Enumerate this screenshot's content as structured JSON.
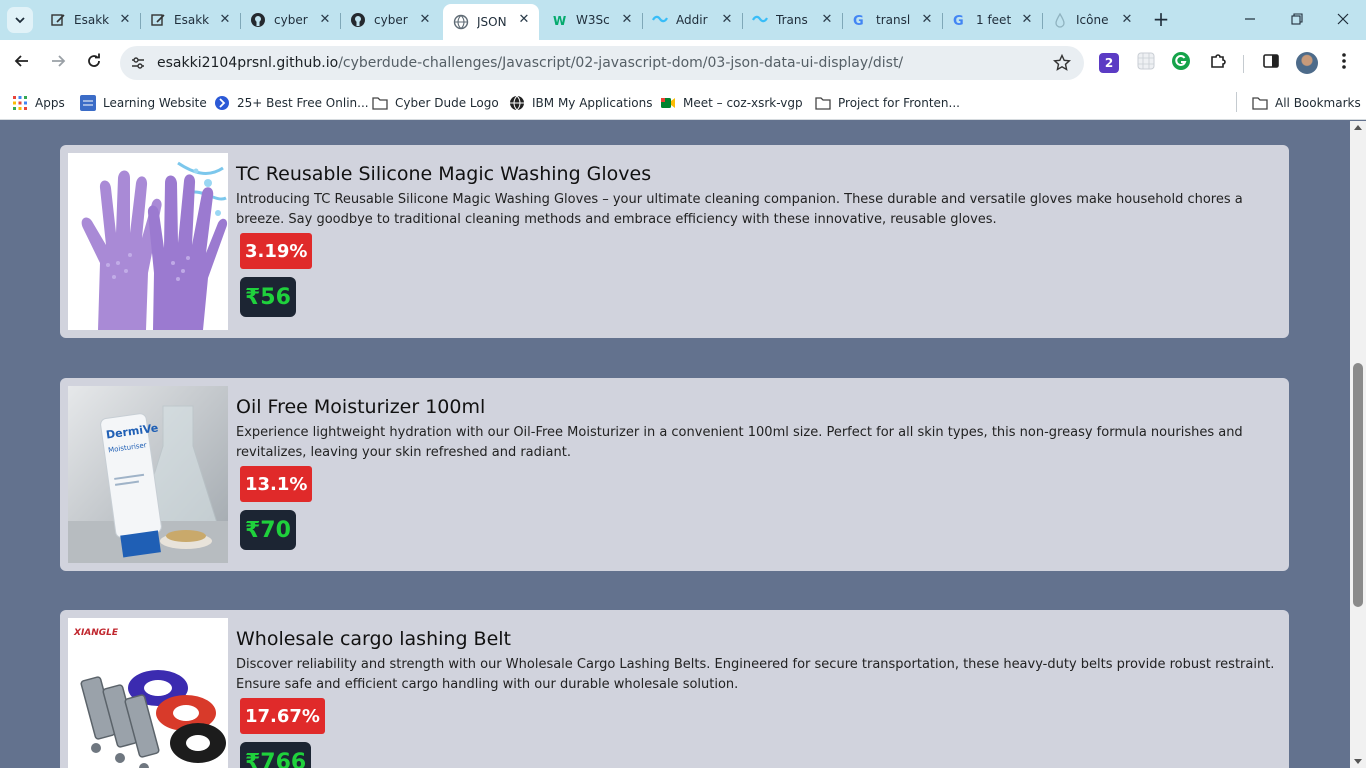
{
  "browser": {
    "tabs": [
      {
        "label": "Esakk",
        "icon": "edit-icon"
      },
      {
        "label": "Esakk",
        "icon": "edit-icon"
      },
      {
        "label": "cyber",
        "icon": "github-icon"
      },
      {
        "label": "cyber",
        "icon": "github-icon"
      },
      {
        "label": "JSON",
        "icon": "globe-icon",
        "active": true
      },
      {
        "label": "W3Sc",
        "icon": "w3schools-icon"
      },
      {
        "label": "Addir",
        "icon": "tailwind-icon"
      },
      {
        "label": "Trans",
        "icon": "tailwind-icon"
      },
      {
        "label": "transl",
        "icon": "google-icon"
      },
      {
        "label": "1 feet",
        "icon": "google-icon"
      },
      {
        "label": "Icône",
        "icon": "drop-icon"
      }
    ],
    "close_glyph": "✕",
    "new_tab_glyph": "+",
    "url_host": "esakki2104prsnl.github.io",
    "url_path": "/cyberdude-challenges/Javascript/02-javascript-dom/03-json-data-ui-display/dist/",
    "extension_badge": "2",
    "bookmarks": [
      {
        "label": "Apps",
        "icon": "apps-grid-icon"
      },
      {
        "label": "Learning Website",
        "icon": "css-grid-icon"
      },
      {
        "label": "25+ Best Free Onlin...",
        "icon": "site-icon"
      },
      {
        "label": "Cyber Dude Logo",
        "icon": "folder-icon"
      },
      {
        "label": "IBM My Applications",
        "icon": "globe-icon"
      },
      {
        "label": "Meet – coz-xsrk-vgp",
        "icon": "meet-icon"
      },
      {
        "label": "Project for Fronten...",
        "icon": "folder-icon"
      }
    ],
    "all_bookmarks": "All Bookmarks"
  },
  "products": [
    {
      "title": "TC Reusable Silicone Magic Washing Gloves",
      "description": "Introducing TC Reusable Silicone Magic Washing Gloves – your ultimate cleaning companion. These durable and versatile gloves make household chores a breeze. Say goodbye to traditional cleaning methods and embrace efficiency with these innovative, reusable gloves.",
      "discount": "3.19%",
      "price": "₹56"
    },
    {
      "title": "Oil Free Moisturizer 100ml",
      "description": "Experience lightweight hydration with our Oil-Free Moisturizer in a convenient 100ml size. Perfect for all skin types, this non-greasy formula nourishes and revitalizes, leaving your skin refreshed and radiant.",
      "discount": "13.1%",
      "price": "₹70",
      "image_text": [
        "DermiVe",
        "Moisturiser"
      ]
    },
    {
      "title": "Wholesale cargo lashing Belt",
      "description": "Discover reliability and strength with our Wholesale Cargo Lashing Belts. Engineered for secure transportation, these heavy-duty belts provide robust restraint. Ensure safe and efficient cargo handling with our durable wholesale solution.",
      "discount": "17.67%",
      "price": "₹766",
      "image_text": [
        "XIANGLE"
      ]
    }
  ],
  "colors": {
    "page_bg": "#63728e",
    "card_bg": "#d1d3dd",
    "discount_bg": "#e02a2a",
    "price_bg": "#1c2533",
    "price_text": "#1fd13c"
  }
}
